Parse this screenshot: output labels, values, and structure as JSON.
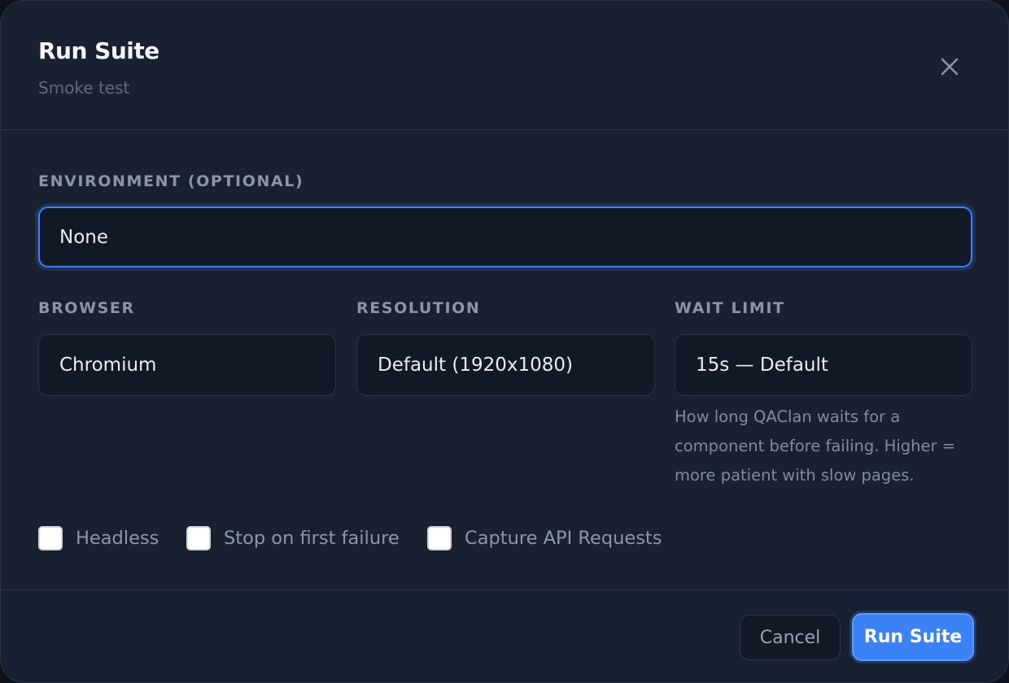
{
  "dialog": {
    "title": "Run Suite",
    "subtitle": "Smoke test",
    "close_icon": "close-icon"
  },
  "environment": {
    "label": "ENVIRONMENT (OPTIONAL)",
    "value": "None"
  },
  "browser": {
    "label": "BROWSER",
    "value": "Chromium"
  },
  "resolution": {
    "label": "RESOLUTION",
    "value": "Default (1920x1080)"
  },
  "wait_limit": {
    "label": "WAIT LIMIT",
    "value": "15s — Default",
    "help": "How long QAClan waits for a component before failing. Higher = more patient with slow pages."
  },
  "options": [
    {
      "label": "Headless",
      "checked": false
    },
    {
      "label": "Stop on first failure",
      "checked": false
    },
    {
      "label": "Capture API Requests",
      "checked": false
    }
  ],
  "footer": {
    "cancel_label": "Cancel",
    "run_label": "Run Suite"
  },
  "colors": {
    "accent": "#3b82f6",
    "background": "#192131"
  }
}
